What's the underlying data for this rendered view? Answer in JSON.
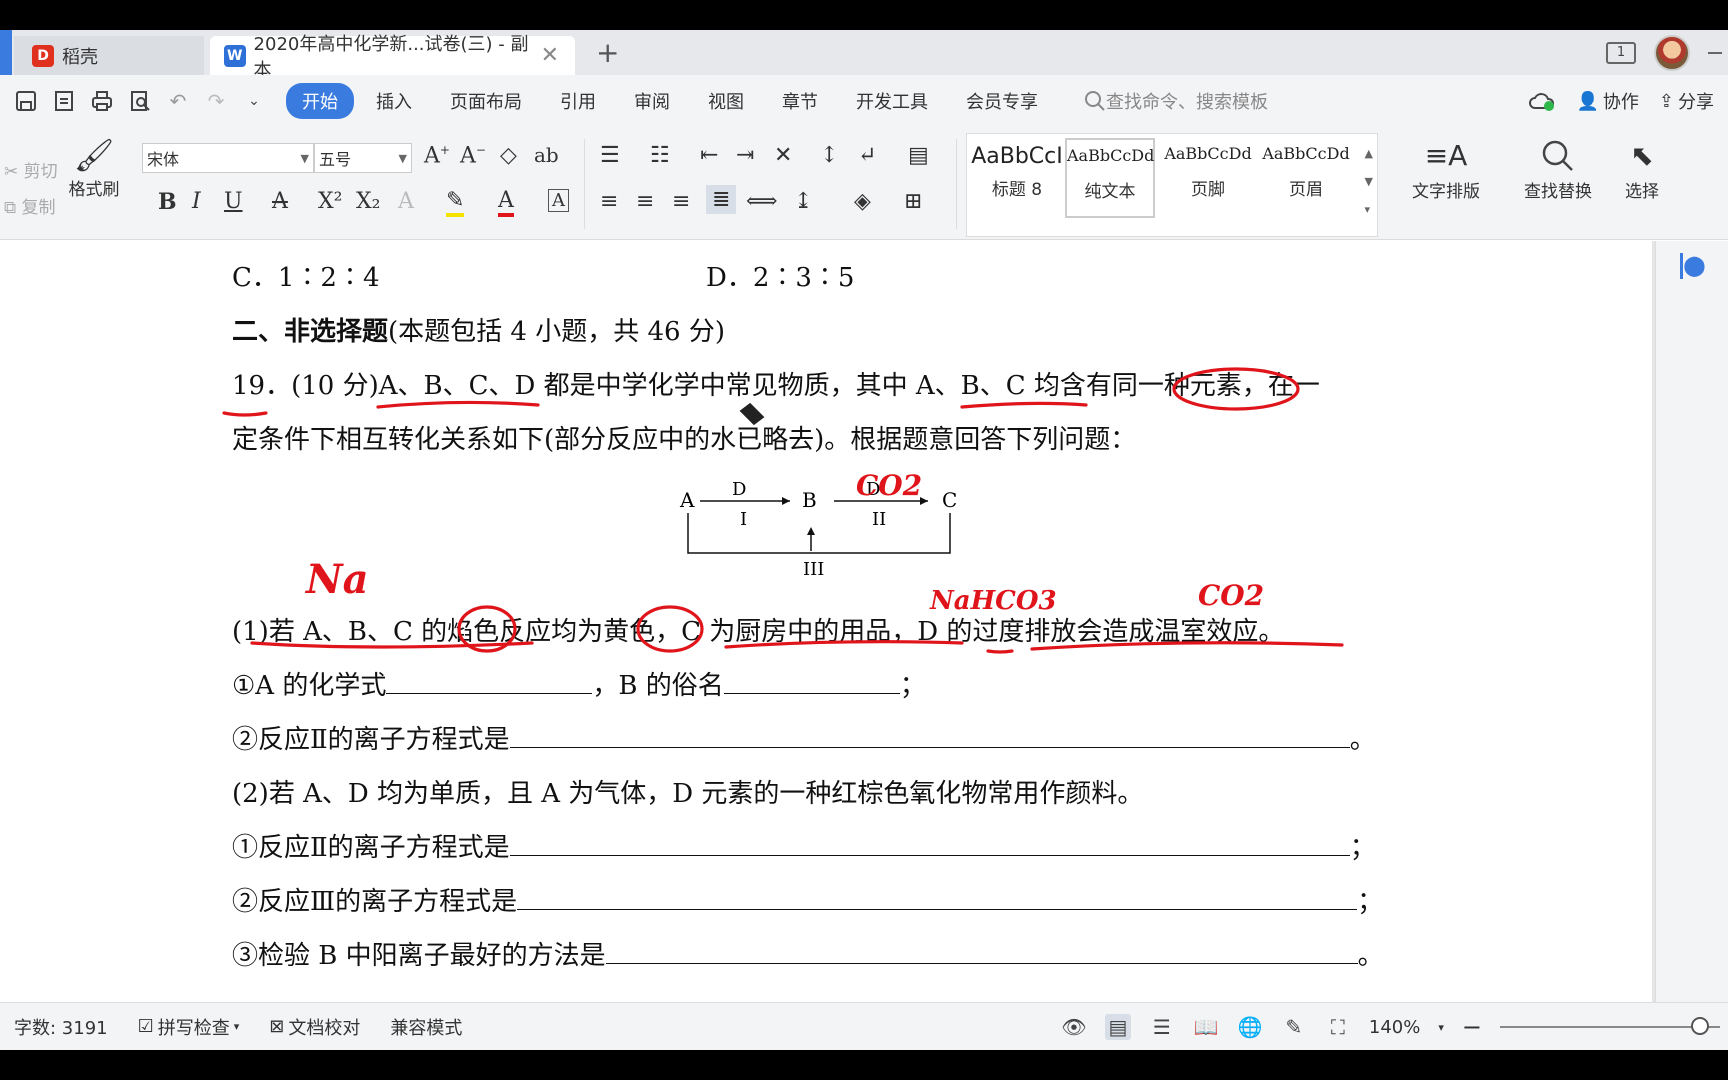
{
  "tabs": {
    "app_tab": "稻壳",
    "doc_tab": "2020年高中化学新...试卷(三) - 副本",
    "close_glyph": "✕",
    "new_tab_glyph": "+",
    "page_indicator": "1"
  },
  "menu": {
    "items": [
      "开始",
      "插入",
      "页面布局",
      "引用",
      "审阅",
      "视图",
      "章节",
      "开发工具",
      "会员专享"
    ],
    "search_placeholder": "查找命令、搜索模板",
    "collab": "协作",
    "share": "分享"
  },
  "ribbon": {
    "cut": "剪切",
    "copy": "复制",
    "format_painter": "格式刷",
    "font_name": "宋体",
    "font_size": "五号",
    "styles": [
      {
        "sample": "AaBbCcI",
        "name": "标题 8"
      },
      {
        "sample": "AaBbCcDd",
        "name": "纯文本"
      },
      {
        "sample": "AaBbCcDd",
        "name": "页脚"
      },
      {
        "sample": "AaBbCcDd",
        "name": "页眉"
      }
    ],
    "text_layout": "文字排版",
    "find_replace": "查找替换",
    "select": "选择"
  },
  "document": {
    "options_c": "C．1∶2∶4",
    "options_d": "D．2∶3∶5",
    "section_title": "二、非选择题",
    "section_note": "(本题包括 4 小题，共 46 分)",
    "q19_line1": "19．(10 分)A、B、C、D 都是中学化学中常见物质，其中 A、B、C 均含有同一种元素，在一",
    "q19_line2": "定条件下相互转化关系如下(部分反应中的水已略去)。根据题意回答下列问题：",
    "diagram": {
      "node_a": "A",
      "node_b": "B",
      "node_c": "C",
      "arrow1_top": "D",
      "arrow1_bottom": "I",
      "arrow2_top": "D",
      "arrow2_bottom": "II",
      "arrow3_label": "III"
    },
    "p1_intro": "(1)若 A、B、C 的焰色反应均为黄色，C 为厨房中的用品，D 的过度排放会造成温室效应。",
    "p1_q1_a": "①A 的化学式",
    "p1_q1_b": "，B 的俗名",
    "p1_q1_end": "；",
    "p1_q2": "②反应Ⅱ的离子方程式是",
    "p1_q2_end": "。",
    "p2_intro": "(2)若 A、D 均为单质，且 A 为气体，D 元素的一种红棕色氧化物常用作颜料。",
    "p2_q1": "①反应Ⅱ的离子方程式是",
    "p2_q1_end": "；",
    "p2_q2": "②反应Ⅲ的离子方程式是",
    "p2_q2_end": "；",
    "p2_q3": "③检验 B 中阳离子最好的方法是",
    "p2_q3_end": "。",
    "handwriting": {
      "na": "Na",
      "co2_top": "CO2",
      "nahco3": "NaHCO3",
      "co2_right": "CO2"
    }
  },
  "status": {
    "word_count": "字数: 3191",
    "spell_check": "拼写检查",
    "proofread": "文档校对",
    "compat_mode": "兼容模式",
    "zoom": "140%",
    "zoom_level_fraction": 0.91
  },
  "colors": {
    "accent": "#3a7be0",
    "ink_red": "#e0151b"
  }
}
